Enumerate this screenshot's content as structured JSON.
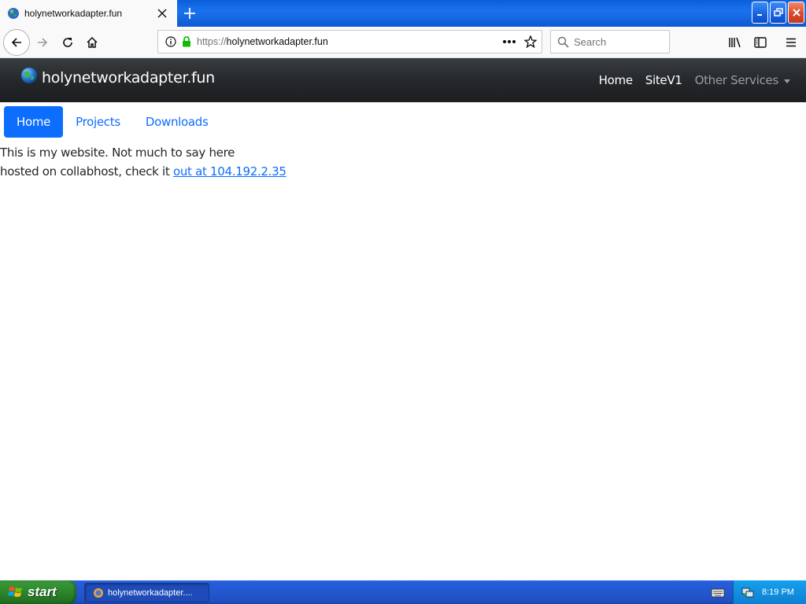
{
  "browser": {
    "tab": {
      "title": "holynetworkadapter.fun",
      "icon": "globe-icon"
    },
    "address": {
      "scheme": "https://",
      "host": "holynetworkadapter.fun"
    },
    "search": {
      "placeholder": "Search"
    }
  },
  "site": {
    "brand": "holynetworkadapter.fun",
    "nav": {
      "home": "Home",
      "sitev1": "SiteV1",
      "other": "Other Services"
    },
    "pills": {
      "home": "Home",
      "projects": "Projects",
      "downloads": "Downloads"
    },
    "content": {
      "line1": "This is my website. Not much to say here",
      "line2": "hosted on collabhost, check it ",
      "link": "out at 104.192.2.35"
    }
  },
  "taskbar": {
    "start": "start",
    "task_label": "holynetworkadapter....",
    "clock": "8:19 PM"
  },
  "colors": {
    "accent": "#0d6efd",
    "header_bg": "#24272a",
    "taskbar": "#245ddb",
    "start_green": "#2f8b2f"
  }
}
